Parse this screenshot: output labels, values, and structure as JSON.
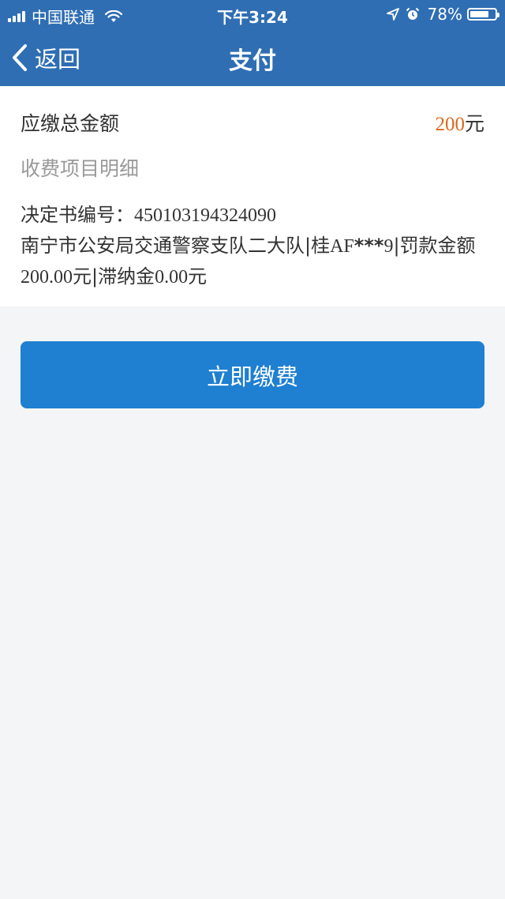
{
  "status_bar": {
    "carrier": "中国联通",
    "time": "下午3:24",
    "battery_percent": "78%",
    "battery_level": 0.78,
    "icons": [
      "signal-icon",
      "wifi-icon",
      "location-arrow-icon",
      "alarm-icon",
      "battery-icon"
    ]
  },
  "nav": {
    "back_label": "返回",
    "title": "支付"
  },
  "payment": {
    "total_label": "应缴总金额",
    "total_amount": "200",
    "total_unit": "元",
    "items_title": "收费项目明细",
    "decision_label": "决定书编号：",
    "decision_number": "450103194324090",
    "detail_prefix": "南宁市公安局交通警察支队二大队|桂",
    "plate_letters": "AF",
    "plate_mask": "***",
    "plate_tail": "9",
    "detail_fine_label": "|罚款金额",
    "fine_amount": "200.00",
    "detail_late_label": "元|滞纳金",
    "late_fee": "0.00",
    "detail_suffix": "元"
  },
  "actions": {
    "pay_button_label": "立即缴费"
  },
  "colors": {
    "header_bg": "#2f6eb3",
    "button_bg": "#1f7fd0",
    "amount_color": "#d9691e",
    "page_bg": "#f4f5f6"
  }
}
